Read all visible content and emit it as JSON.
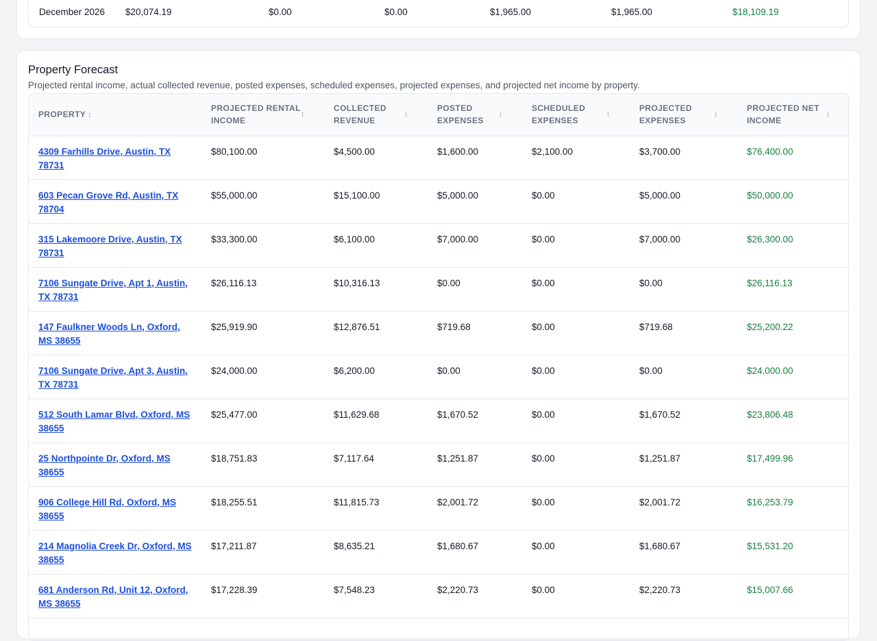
{
  "colors": {
    "link": "#1d4ed8",
    "positive": "#15803d",
    "header_text": "#6b7280",
    "border": "#e5e7eb"
  },
  "summary_row": {
    "month": "December 2026",
    "values": [
      "$20,074.19",
      "$0.00",
      "$0.00",
      "$1,965.00",
      "$1,965.00",
      "$18,109.19"
    ]
  },
  "property_forecast": {
    "title": "Property Forecast",
    "subtitle": "Projected rental income, actual collected revenue, posted expenses, scheduled expenses, projected expenses, and projected net income by property.",
    "sort_icon": "sort-updown-icon",
    "columns": [
      "Property",
      "Projected Rental Income",
      "Collected Revenue",
      "Posted Expenses",
      "Scheduled Expenses",
      "Projected Expenses",
      "Projected Net Income"
    ],
    "rows": [
      {
        "property": "4309 Farhills Drive, Austin, TX 78731",
        "projected_rental_income": "$80,100.00",
        "collected_revenue": "$4,500.00",
        "posted_expenses": "$1,600.00",
        "scheduled_expenses": "$2,100.00",
        "projected_expenses": "$3,700.00",
        "projected_net_income": "$76,400.00"
      },
      {
        "property": "603 Pecan Grove Rd, Austin, TX 78704",
        "projected_rental_income": "$55,000.00",
        "collected_revenue": "$15,100.00",
        "posted_expenses": "$5,000.00",
        "scheduled_expenses": "$0.00",
        "projected_expenses": "$5,000.00",
        "projected_net_income": "$50,000.00"
      },
      {
        "property": "315 Lakemoore Drive, Austin, TX 78731",
        "projected_rental_income": "$33,300.00",
        "collected_revenue": "$6,100.00",
        "posted_expenses": "$7,000.00",
        "scheduled_expenses": "$0.00",
        "projected_expenses": "$7,000.00",
        "projected_net_income": "$26,300.00"
      },
      {
        "property": "7106 Sungate Drive, Apt 1, Austin, TX 78731",
        "projected_rental_income": "$26,116.13",
        "collected_revenue": "$10,316.13",
        "posted_expenses": "$0.00",
        "scheduled_expenses": "$0.00",
        "projected_expenses": "$0.00",
        "projected_net_income": "$26,116.13"
      },
      {
        "property": "147 Faulkner Woods Ln, Oxford, MS 38655",
        "projected_rental_income": "$25,919.90",
        "collected_revenue": "$12,876.51",
        "posted_expenses": "$719.68",
        "scheduled_expenses": "$0.00",
        "projected_expenses": "$719.68",
        "projected_net_income": "$25,200.22"
      },
      {
        "property": "7106 Sungate Drive, Apt 3, Austin, TX 78731",
        "projected_rental_income": "$24,000.00",
        "collected_revenue": "$6,200.00",
        "posted_expenses": "$0.00",
        "scheduled_expenses": "$0.00",
        "projected_expenses": "$0.00",
        "projected_net_income": "$24,000.00"
      },
      {
        "property": "512 South Lamar Blvd, Oxford, MS 38655",
        "projected_rental_income": "$25,477.00",
        "collected_revenue": "$11,629.68",
        "posted_expenses": "$1,670.52",
        "scheduled_expenses": "$0.00",
        "projected_expenses": "$1,670.52",
        "projected_net_income": "$23,806.48"
      },
      {
        "property": "25 Northpointe Dr, Oxford, MS 38655",
        "projected_rental_income": "$18,751.83",
        "collected_revenue": "$7,117.64",
        "posted_expenses": "$1,251.87",
        "scheduled_expenses": "$0.00",
        "projected_expenses": "$1,251.87",
        "projected_net_income": "$17,499.96"
      },
      {
        "property": "906 College Hill Rd, Oxford, MS 38655",
        "projected_rental_income": "$18,255.51",
        "collected_revenue": "$11,815.73",
        "posted_expenses": "$2,001.72",
        "scheduled_expenses": "$0.00",
        "projected_expenses": "$2,001.72",
        "projected_net_income": "$16,253.79"
      },
      {
        "property": "214 Magnolia Creek Dr, Oxford, MS 38655",
        "projected_rental_income": "$17,211.87",
        "collected_revenue": "$8,635.21",
        "posted_expenses": "$1,680.67",
        "scheduled_expenses": "$0.00",
        "projected_expenses": "$1,680.67",
        "projected_net_income": "$15,531.20"
      },
      {
        "property": "681 Anderson Rd, Unit 12, Oxford, MS 38655",
        "projected_rental_income": "$17,228.39",
        "collected_revenue": "$7,548.23",
        "posted_expenses": "$2,220.73",
        "scheduled_expenses": "$0.00",
        "projected_expenses": "$2,220.73",
        "projected_net_income": "$15,007.66"
      }
    ]
  }
}
